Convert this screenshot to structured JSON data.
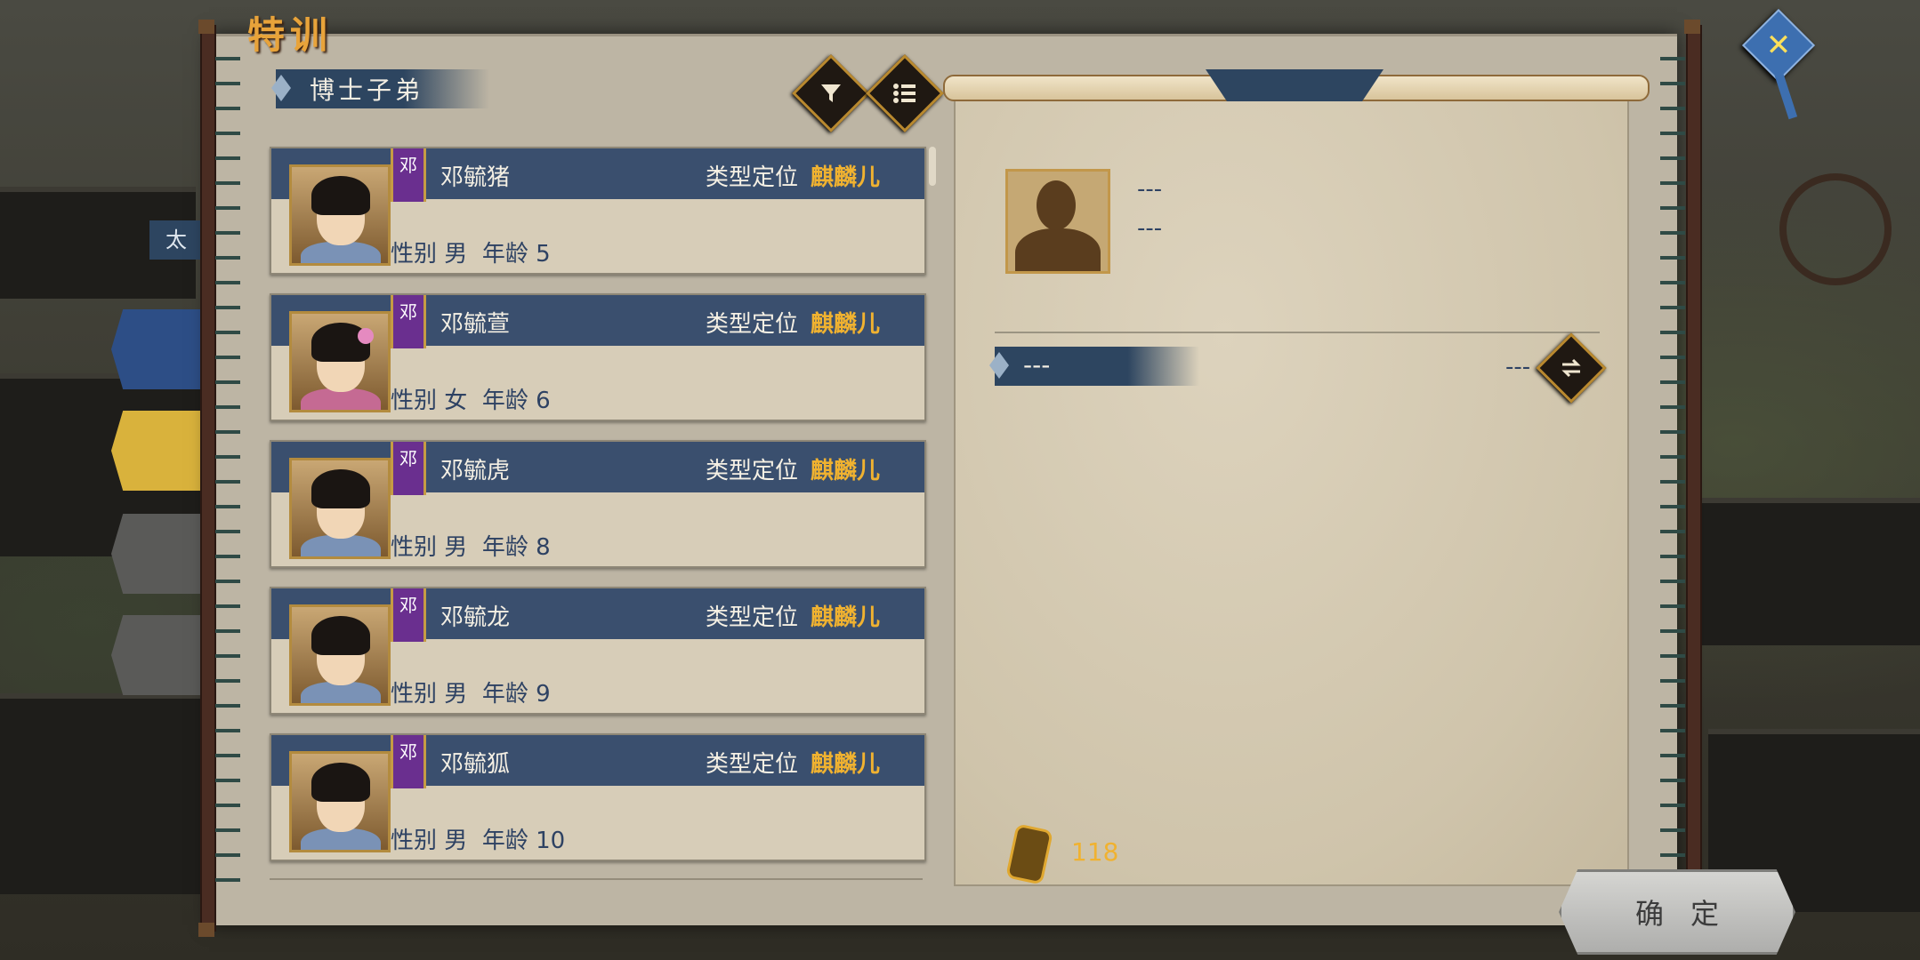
{
  "window": {
    "title": "特训"
  },
  "list": {
    "heading": "博士子弟",
    "filter_icon": "filter-icon",
    "sort_icon": "list-icon",
    "gender_label": "性别",
    "age_label": "年龄",
    "type_label": "类型定位",
    "items": [
      {
        "clan": "邓",
        "name": "邓毓猪",
        "type": "麒麟儿",
        "gender": "男",
        "age": "5"
      },
      {
        "clan": "邓",
        "name": "邓毓萱",
        "type": "麒麟儿",
        "gender": "女",
        "age": "6"
      },
      {
        "clan": "邓",
        "name": "邓毓虎",
        "type": "麒麟儿",
        "gender": "男",
        "age": "8"
      },
      {
        "clan": "邓",
        "name": "邓毓龙",
        "type": "麒麟儿",
        "gender": "男",
        "age": "9"
      },
      {
        "clan": "邓",
        "name": "邓毓狐",
        "type": "麒麟儿",
        "gender": "男",
        "age": "10"
      }
    ]
  },
  "detail": {
    "line1": "---",
    "line2": "---",
    "section_label": "---",
    "section_value": "---",
    "cost": "118"
  },
  "side": {
    "label": "太"
  },
  "confirm_label": "确定",
  "close_icon": "close-icon"
}
